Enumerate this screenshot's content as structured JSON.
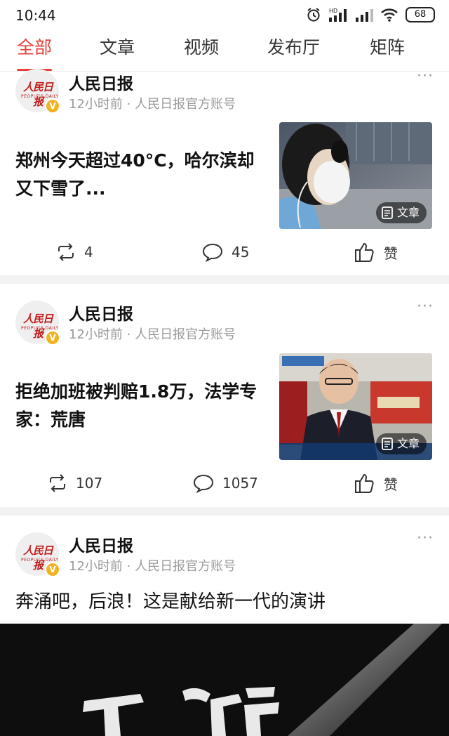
{
  "status": {
    "time": "10:44",
    "battery": "68",
    "hd_label": "HD"
  },
  "tabs": [
    {
      "label": "全部",
      "active": true
    },
    {
      "label": "文章",
      "active": false
    },
    {
      "label": "视频",
      "active": false
    },
    {
      "label": "发布厅",
      "active": false
    },
    {
      "label": "矩阵",
      "active": false
    }
  ],
  "posts": [
    {
      "author": "人民日报",
      "meta": "12小时前 · 人民日报官方账号",
      "headline": "郑州今天超过40°C，哈尔滨却又下雪了...",
      "thumb_badge": "文章",
      "repost": "4",
      "comments": "45",
      "like_label": "赞"
    },
    {
      "author": "人民日报",
      "meta": "12小时前 · 人民日报官方账号",
      "headline": "拒绝加班被判赔1.8万，法学专家：荒唐",
      "thumb_badge": "文章",
      "repost": "107",
      "comments": "1057",
      "like_label": "赞"
    },
    {
      "author": "人民日报",
      "meta": "12小时前 · 人民日报官方账号",
      "headline": "奔涌吧，后浪！这是献给新一代的演讲"
    }
  ],
  "avatar_logo": "人民日报",
  "avatar_logo_sub": "PEOPLE'S DAILY",
  "verified_badge": "V",
  "more_label": "···",
  "colors": {
    "accent": "#e5403c",
    "meta": "#9a9a9a",
    "badge": "#f0b323"
  }
}
